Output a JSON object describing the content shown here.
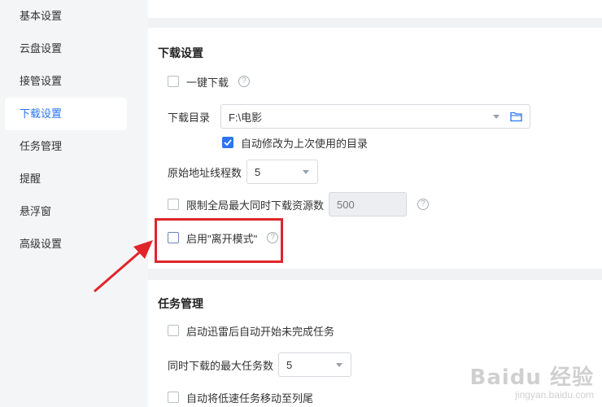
{
  "sidebar": {
    "items": [
      {
        "label": "基本设置",
        "active": false
      },
      {
        "label": "云盘设置",
        "active": false
      },
      {
        "label": "接管设置",
        "active": false
      },
      {
        "label": "下载设置",
        "active": true
      },
      {
        "label": "任务管理",
        "active": false
      },
      {
        "label": "提醒",
        "active": false
      },
      {
        "label": "悬浮窗",
        "active": false
      },
      {
        "label": "高级设置",
        "active": false
      }
    ]
  },
  "download_settings": {
    "title": "下载设置",
    "one_click_download": {
      "label": "一键下载",
      "checked": false
    },
    "download_dir": {
      "label": "下载目录",
      "value": "F:\\电影"
    },
    "auto_modify_dir": {
      "label": "自动修改为上次使用的目录",
      "checked": true
    },
    "origin_threads": {
      "label": "原始地址线程数",
      "value": "5"
    },
    "limit_resources": {
      "label": "限制全局最大同时下载资源数",
      "value": "500",
      "checked": false
    },
    "away_mode": {
      "label": "启用\"离开模式\"",
      "checked": false
    }
  },
  "task_management": {
    "title": "任务管理",
    "auto_start": {
      "label": "启动迅雷后自动开始未完成任务",
      "checked": false
    },
    "max_tasks": {
      "label": "同时下载的最大任务数",
      "value": "5"
    },
    "move_slow": {
      "label": "自动将低速任务移动至列尾",
      "checked": false
    }
  },
  "watermark": {
    "logo": "Baidu 经验",
    "url": "jingyan.baidu.com"
  },
  "colors": {
    "accent": "#2a75f3",
    "highlight": "#e0252a"
  }
}
